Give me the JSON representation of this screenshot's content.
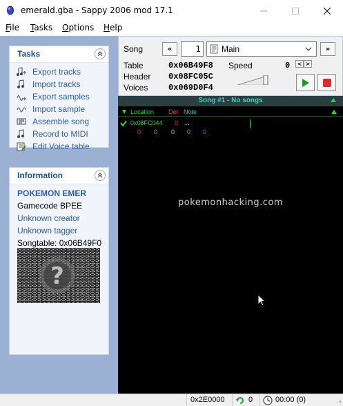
{
  "window": {
    "title": "emerald.gba - Sappy 2006 mod 17.1"
  },
  "menu": {
    "items": [
      {
        "label": "File"
      },
      {
        "label": "Tasks"
      },
      {
        "label": "Options"
      },
      {
        "label": "Help"
      }
    ]
  },
  "tasks_panel": {
    "title": "Tasks",
    "items": [
      {
        "label": "Export tracks",
        "icon": "export-tracks-icon"
      },
      {
        "label": "Import tracks",
        "icon": "import-tracks-icon"
      },
      {
        "label": "Export samples",
        "icon": "export-samples-icon"
      },
      {
        "label": "Import sample",
        "icon": "import-sample-icon"
      },
      {
        "label": "Assemble song",
        "icon": "assemble-song-icon"
      },
      {
        "label": "Record to MIDI",
        "icon": "record-midi-icon"
      },
      {
        "label": "Edit Voice table",
        "icon": "edit-voice-table-icon"
      }
    ]
  },
  "info_panel": {
    "title": "Information",
    "game_name": "POKEMON EMER",
    "gamecode": "Gamecode BPEE",
    "creator": "Unknown creator",
    "tagger": "Unknown tagger",
    "songtable": "Songtable: 0x06B49F0"
  },
  "controls": {
    "song_label": "Song",
    "prev_label": "«",
    "song_number": "1",
    "song_name": "Main",
    "next_label": "»",
    "table_label": "Table",
    "table_value": "0x06B49F8",
    "header_label": "Header",
    "header_value": "0x08FC05C",
    "voices_label": "Voices",
    "voices_value": "0x069D0F4",
    "speed_label": "Speed",
    "speed_value": "0",
    "speed_down": "<",
    "speed_up": ">"
  },
  "track_view": {
    "song_header": "Song #1 - No songs",
    "columns": {
      "location": "Location",
      "del": "Del",
      "note": "Note"
    },
    "row": {
      "location": "0x08FC044",
      "del": "0",
      "note": "..."
    },
    "row2_values": [
      "0",
      "0",
      "0",
      "0",
      "0"
    ],
    "watermark": "pokemonhacking.com"
  },
  "status": {
    "address": "0x2E0000",
    "loops": "0",
    "time": "00:00 (0)"
  },
  "colors": {
    "left_pane_bg": "#9bb1d4",
    "panel_title": "#1f4f8f",
    "link_blue": "#2a5db0",
    "track_bg": "#000000",
    "song_header_text": "#29d6c8",
    "location_green": "#29d640",
    "del_red": "#e04040",
    "note_teal": "#30c8c8"
  }
}
